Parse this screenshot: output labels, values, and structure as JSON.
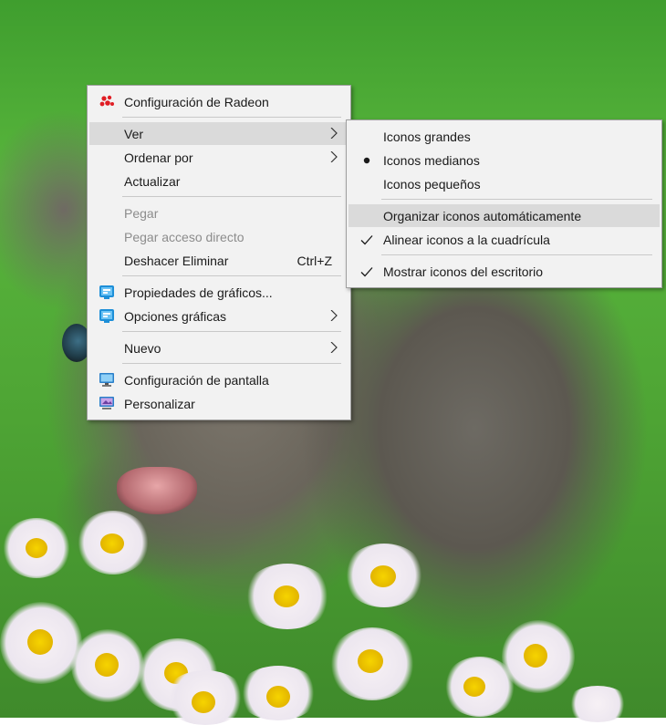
{
  "context_menu": {
    "items": [
      {
        "label": "Configuración de Radeon",
        "icon": "radeon-icon"
      },
      {
        "label": "Ver",
        "icon": "submenu-arrow-icon"
      },
      {
        "label": "Ordenar por",
        "icon": "submenu-arrow-icon"
      },
      {
        "label": "Actualizar"
      },
      {
        "label": "Pegar",
        "disabled": true
      },
      {
        "label": "Pegar acceso directo",
        "disabled": true
      },
      {
        "label": "Deshacer Eliminar",
        "shortcut": "Ctrl+Z"
      },
      {
        "label": "Propiedades de gráficos...",
        "icon": "intel-graphics-icon"
      },
      {
        "label": "Opciones gráficas",
        "icon": "intel-graphics-icon"
      },
      {
        "label": "Nuevo",
        "icon": "submenu-arrow-icon"
      },
      {
        "label": "Configuración de pantalla",
        "icon": "display-icon"
      },
      {
        "label": "Personalizar",
        "icon": "personalize-icon"
      }
    ]
  },
  "view_submenu": {
    "items": [
      {
        "label": "Iconos grandes"
      },
      {
        "label": "Iconos medianos",
        "selected": true
      },
      {
        "label": "Iconos pequeños"
      },
      {
        "label": "Organizar iconos automáticamente"
      },
      {
        "label": "Alinear iconos a la cuadrícula",
        "checked": true
      },
      {
        "label": "Mostrar iconos del escritorio",
        "checked": true
      }
    ]
  },
  "colors": {
    "menu_bg": "#f2f2f2",
    "highlight": "#dadada",
    "disabled_text": "#8c8c8c",
    "radeon_red": "#e01e25"
  }
}
